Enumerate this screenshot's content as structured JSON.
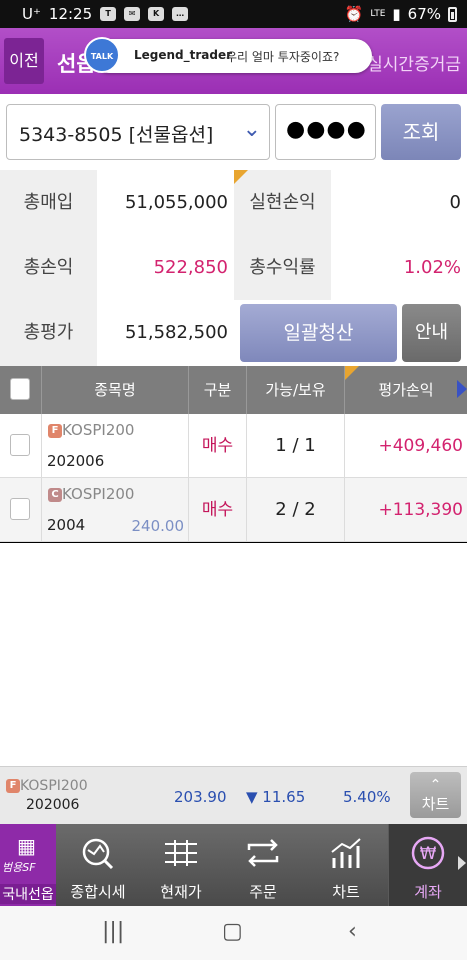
{
  "status_bar": {
    "carrier": "U⁺",
    "time": "12:25",
    "network": "LTE",
    "battery": "67%"
  },
  "header": {
    "back_label": "이전",
    "title": "선옵",
    "right_label": "실시간증거금",
    "chat": {
      "avatar_text": "TALK",
      "name": "Legend_trader",
      "message": "우리 얼마 투자중이죠?"
    }
  },
  "account": {
    "selected": "5343-8505 [선물옵션]",
    "password_mask": "●●●●",
    "query_label": "조회"
  },
  "summary": {
    "total_buy_label": "총매입",
    "total_buy": "51,055,000",
    "realized_label": "실현손익",
    "realized": "0",
    "total_pnl_label": "총손익",
    "total_pnl": "522,850",
    "total_return_label": "총수익률",
    "total_return": "1.02%",
    "total_eval_label": "총평가",
    "total_eval": "51,582,500",
    "liquidate_label": "일괄청산",
    "guide_label": "안내"
  },
  "table": {
    "headers": [
      "종목명",
      "구분",
      "가능/보유",
      "평가손익"
    ],
    "rows": [
      {
        "type_badge": "F",
        "name": "KOSPI200",
        "code": "202006",
        "strike": "",
        "side": "매수",
        "qty": "1 / 1",
        "pnl": "+409,460"
      },
      {
        "type_badge": "C",
        "name": "KOSPI200",
        "code": "2004",
        "strike": "240.00",
        "side": "매수",
        "qty": "2 / 2",
        "pnl": "+113,390"
      }
    ]
  },
  "ticker": {
    "badge": "F",
    "name": "KOSPI200",
    "code": "202006",
    "price": "203.90",
    "change": "▼ 11.65",
    "rate": "5.40%",
    "chart_label": "차트"
  },
  "bottom_nav": {
    "home_brand": "범용SF",
    "home_label": "국내선옵",
    "items": [
      "종합시세",
      "현재가",
      "주문",
      "차트",
      "계좌"
    ]
  },
  "colors": {
    "brand_purple": "#9b2fb4",
    "positive_pink": "#d3236f",
    "negative_blue": "#2a4fb0"
  }
}
